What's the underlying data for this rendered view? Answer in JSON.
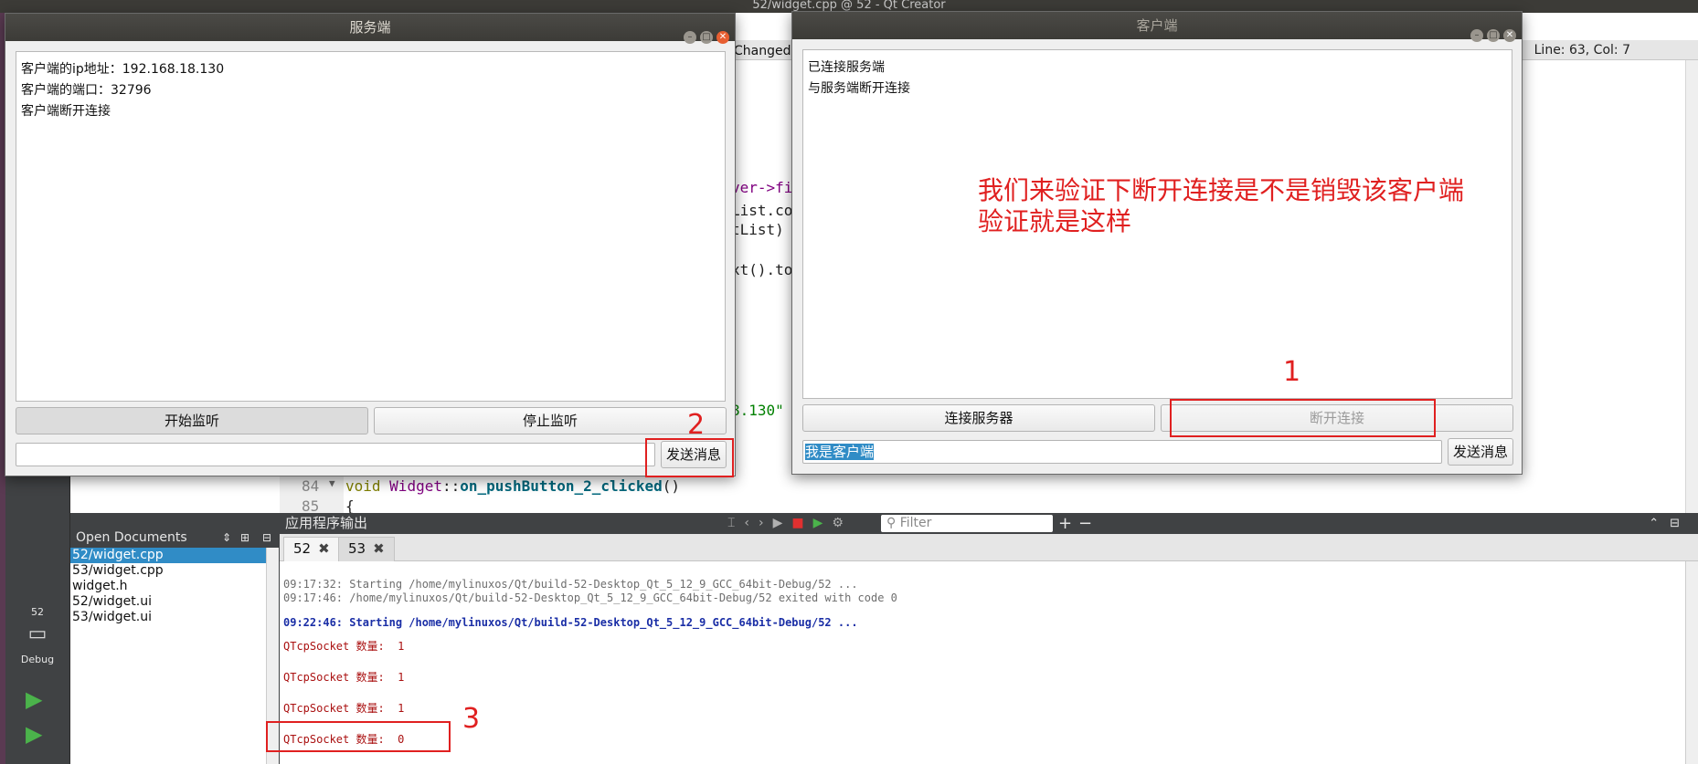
{
  "qtcreator": {
    "window_title": "52/widget.cpp @ 52 - Qt Creator",
    "changed_label": "Changed(",
    "line_col": "Line: 63, Col: 7",
    "code_fragments": {
      "frag_1": "ver->fi",
      "frag_2": "List.co",
      "frag_3": "tList)",
      "frag_4": "xt().to",
      "frag_5": "8.130\""
    },
    "code_line_84_num": "84",
    "code_line_85_num": "85",
    "code_line_84": {
      "kw": "void",
      "cls": "Widget",
      "sep": "::",
      "fn": "on_pushButton_2_clicked",
      "paren": "()"
    },
    "code_line_85": "{",
    "mode_bar": {
      "project": "52",
      "mode": "Debug"
    },
    "open_documents": {
      "title": "Open Documents",
      "items": [
        "52/widget.cpp",
        "53/widget.cpp",
        "widget.h",
        "52/widget.ui",
        "53/widget.ui"
      ]
    },
    "output_pane": {
      "title": "应用程序输出",
      "filter_placeholder": "Filter",
      "tabs": [
        {
          "label": "52"
        },
        {
          "label": "53"
        }
      ],
      "lines": [
        "09:17:32: Starting /home/mylinuxos/Qt/build-52-Desktop_Qt_5_12_9_GCC_64bit-Debug/52 ...",
        "09:17:46: /home/mylinuxos/Qt/build-52-Desktop_Qt_5_12_9_GCC_64bit-Debug/52 exited with code 0",
        "09:22:46: Starting /home/mylinuxos/Qt/build-52-Desktop_Qt_5_12_9_GCC_64bit-Debug/52 ...",
        "QTcpSocket 数量:  1",
        "QTcpSocket 数量:  1",
        "QTcpSocket 数量:  1",
        "QTcpSocket 数量:  0"
      ]
    }
  },
  "server_window": {
    "title": "服务端",
    "log_lines": [
      "客户端的ip地址：192.168.18.130",
      "客户端的端口：32796",
      "客户端断开连接"
    ],
    "start_button": "开始监听",
    "stop_button": "停止监听",
    "message_value": "",
    "send_button": "发送消息"
  },
  "client_window": {
    "title": "客户端",
    "log_lines": [
      "已连接服务端",
      "与服务端断开连接"
    ],
    "connect_button": "连接服务器",
    "disconnect_button": "断开连接",
    "message_value": "我是客户端",
    "send_button": "发送消息"
  },
  "annotations": {
    "note_line_1": "我们来验证下断开连接是不是销毁该客户端",
    "note_line_2": "验证就是这样",
    "num_1": "1",
    "num_2": "2",
    "num_3": "3",
    "color": "#e02020"
  }
}
